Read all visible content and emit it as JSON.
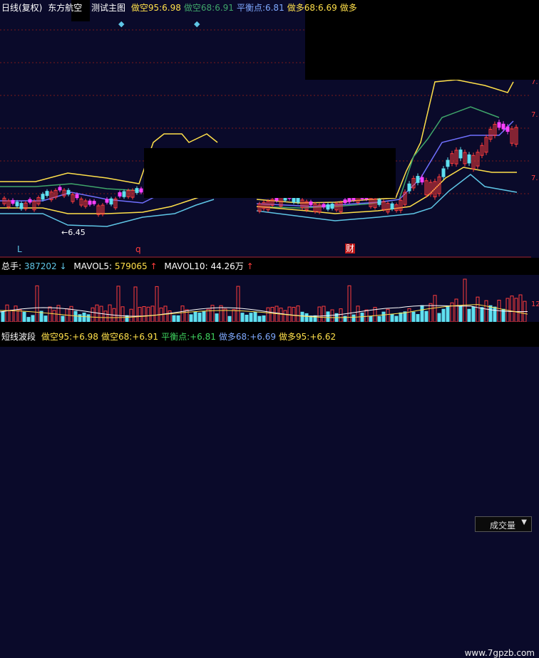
{
  "header": {
    "title": "日线(复权)",
    "stock": "东方航空",
    "indicator": "测试主图",
    "values": [
      {
        "label": "做空95:",
        "value": "6.98",
        "color": "#ffe04a"
      },
      {
        "label": "做空68:",
        "value": "6.91",
        "color": "#3fa56a"
      },
      {
        "label": "平衡点:",
        "value": "6.81",
        "color": "#7fa9ff"
      },
      {
        "label": "做多68:",
        "value": "6.69",
        "color": "#ffe04a"
      },
      {
        "label": "做多",
        "value": "",
        "color": "#ffe04a"
      }
    ]
  },
  "markers": {
    "min_price": "6.45",
    "left_label": "L",
    "q_label": "q",
    "cai_label": "财"
  },
  "right_scale": [
    "7.",
    "7.",
    "7."
  ],
  "volume": {
    "total_label": "总手:",
    "total_value": "387202",
    "mavol5_label": "MAVOL5:",
    "mavol5_value": "579065",
    "mavol10_label": "MAVOL10:",
    "mavol10_value": "44.26万",
    "dropdown_label": "成交量",
    "scale_label": "12"
  },
  "bottom": {
    "title": "短线波段",
    "values": [
      {
        "label": "做空95:",
        "value": "+6.98",
        "color": "#ffe04a"
      },
      {
        "label": "做空68:",
        "value": "+6.91",
        "color": "#ffe04a"
      },
      {
        "label": "平衡点:",
        "value": "+6.81",
        "color": "#3fd45f"
      },
      {
        "label": "做多68:",
        "value": "+6.69",
        "color": "#7fa9ff"
      },
      {
        "label": "做多95:",
        "value": "+6.62",
        "color": "#ffe04a"
      }
    ],
    "watermark": "www.7gpzb.com"
  },
  "colors": {
    "up": "#ff3c3c",
    "down": "#5fe0f0",
    "pink": "#ff40ff",
    "band_yellow": "#ffe04a",
    "band_cyan": "#5fc6e6",
    "band_green": "#3fa56a",
    "ma_blue": "#7070ff"
  }
}
